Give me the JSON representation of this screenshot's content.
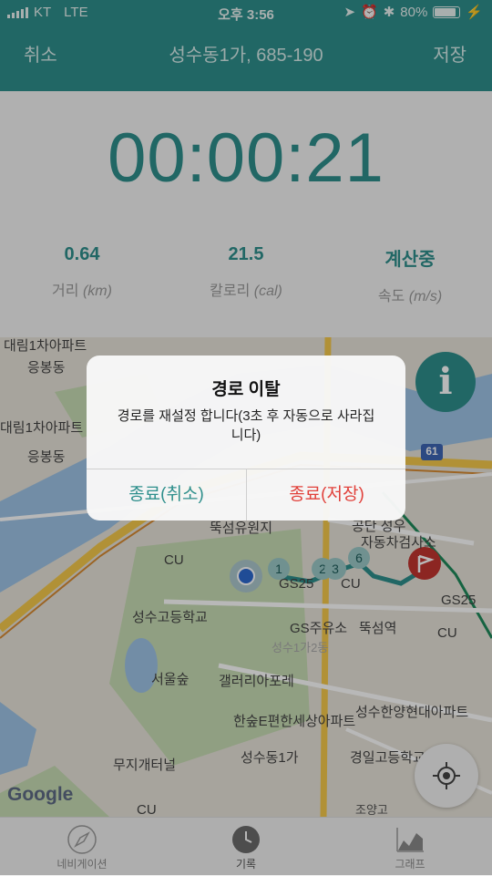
{
  "status": {
    "carrier": "KT",
    "network": "LTE",
    "time": "오후 3:56",
    "battery": "80%"
  },
  "nav": {
    "left": "취소",
    "title": "성수동1가, 685-190",
    "right": "저장"
  },
  "timer": "00:00:21",
  "metrics": [
    {
      "value": "0.64",
      "label": "거리",
      "unit": "(km)"
    },
    {
      "value": "21.5",
      "label": "칼로리",
      "unit": "(cal)"
    },
    {
      "value": "계산중",
      "label": "속도",
      "unit": "(m/s)"
    }
  ],
  "map": {
    "labels": [
      "대림1차아파트",
      "응봉동",
      "대림1차아파트",
      "응봉동",
      "뚝섬유원지",
      "CU",
      "성수고등학교",
      "GS주유소",
      "서울숲",
      "갤러리아포레",
      "한숲E편한세상아파트",
      "무지개터널",
      "성수동1가",
      "경일고등학교",
      "성수한양현대아파트",
      "CU",
      "성수1가2동",
      "뚝섬역",
      "공단 성우",
      "자동차검사소",
      "GS25",
      "CU",
      "GS25",
      "CU",
      "조양고"
    ],
    "road_sign": "61",
    "waypoints": [
      "1",
      "2",
      "3",
      "6"
    ],
    "google": "Google"
  },
  "tabs": [
    {
      "label": "네비게이션",
      "icon": "compass-icon"
    },
    {
      "label": "기록",
      "icon": "clock-icon"
    },
    {
      "label": "그래프",
      "icon": "area-chart-icon"
    }
  ],
  "dialog": {
    "title": "경로 이탈",
    "message": "경로를 재설정 합니다(3초 후 자동으로 사라집니다)",
    "cancel": "종료(취소)",
    "save": "종료(저장)"
  },
  "colors": {
    "accent": "#2e8f8c",
    "danger": "#e1413b"
  }
}
